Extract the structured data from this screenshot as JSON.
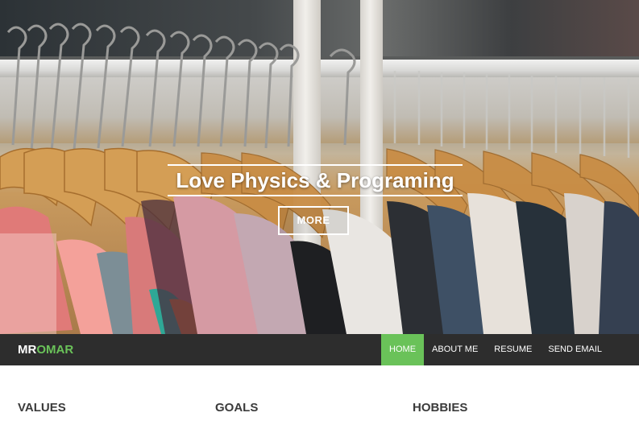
{
  "hero": {
    "title": "Love Physics & Programing",
    "more_label": "MORE"
  },
  "navbar": {
    "brand_part1": "MR",
    "brand_part2": "OMAR",
    "items": [
      {
        "label": "HOME",
        "active": true
      },
      {
        "label": "ABOUT ME",
        "active": false
      },
      {
        "label": "RESUME",
        "active": false
      },
      {
        "label": "SEND EMAIL",
        "active": false
      }
    ]
  },
  "sections": [
    {
      "title": "VALUES"
    },
    {
      "title": "GOALS"
    },
    {
      "title": "HOBBIES"
    }
  ],
  "colors": {
    "accent": "#6ac259",
    "navbar_bg": "#2d2d2d",
    "heading_text": "#3b3b3b"
  }
}
